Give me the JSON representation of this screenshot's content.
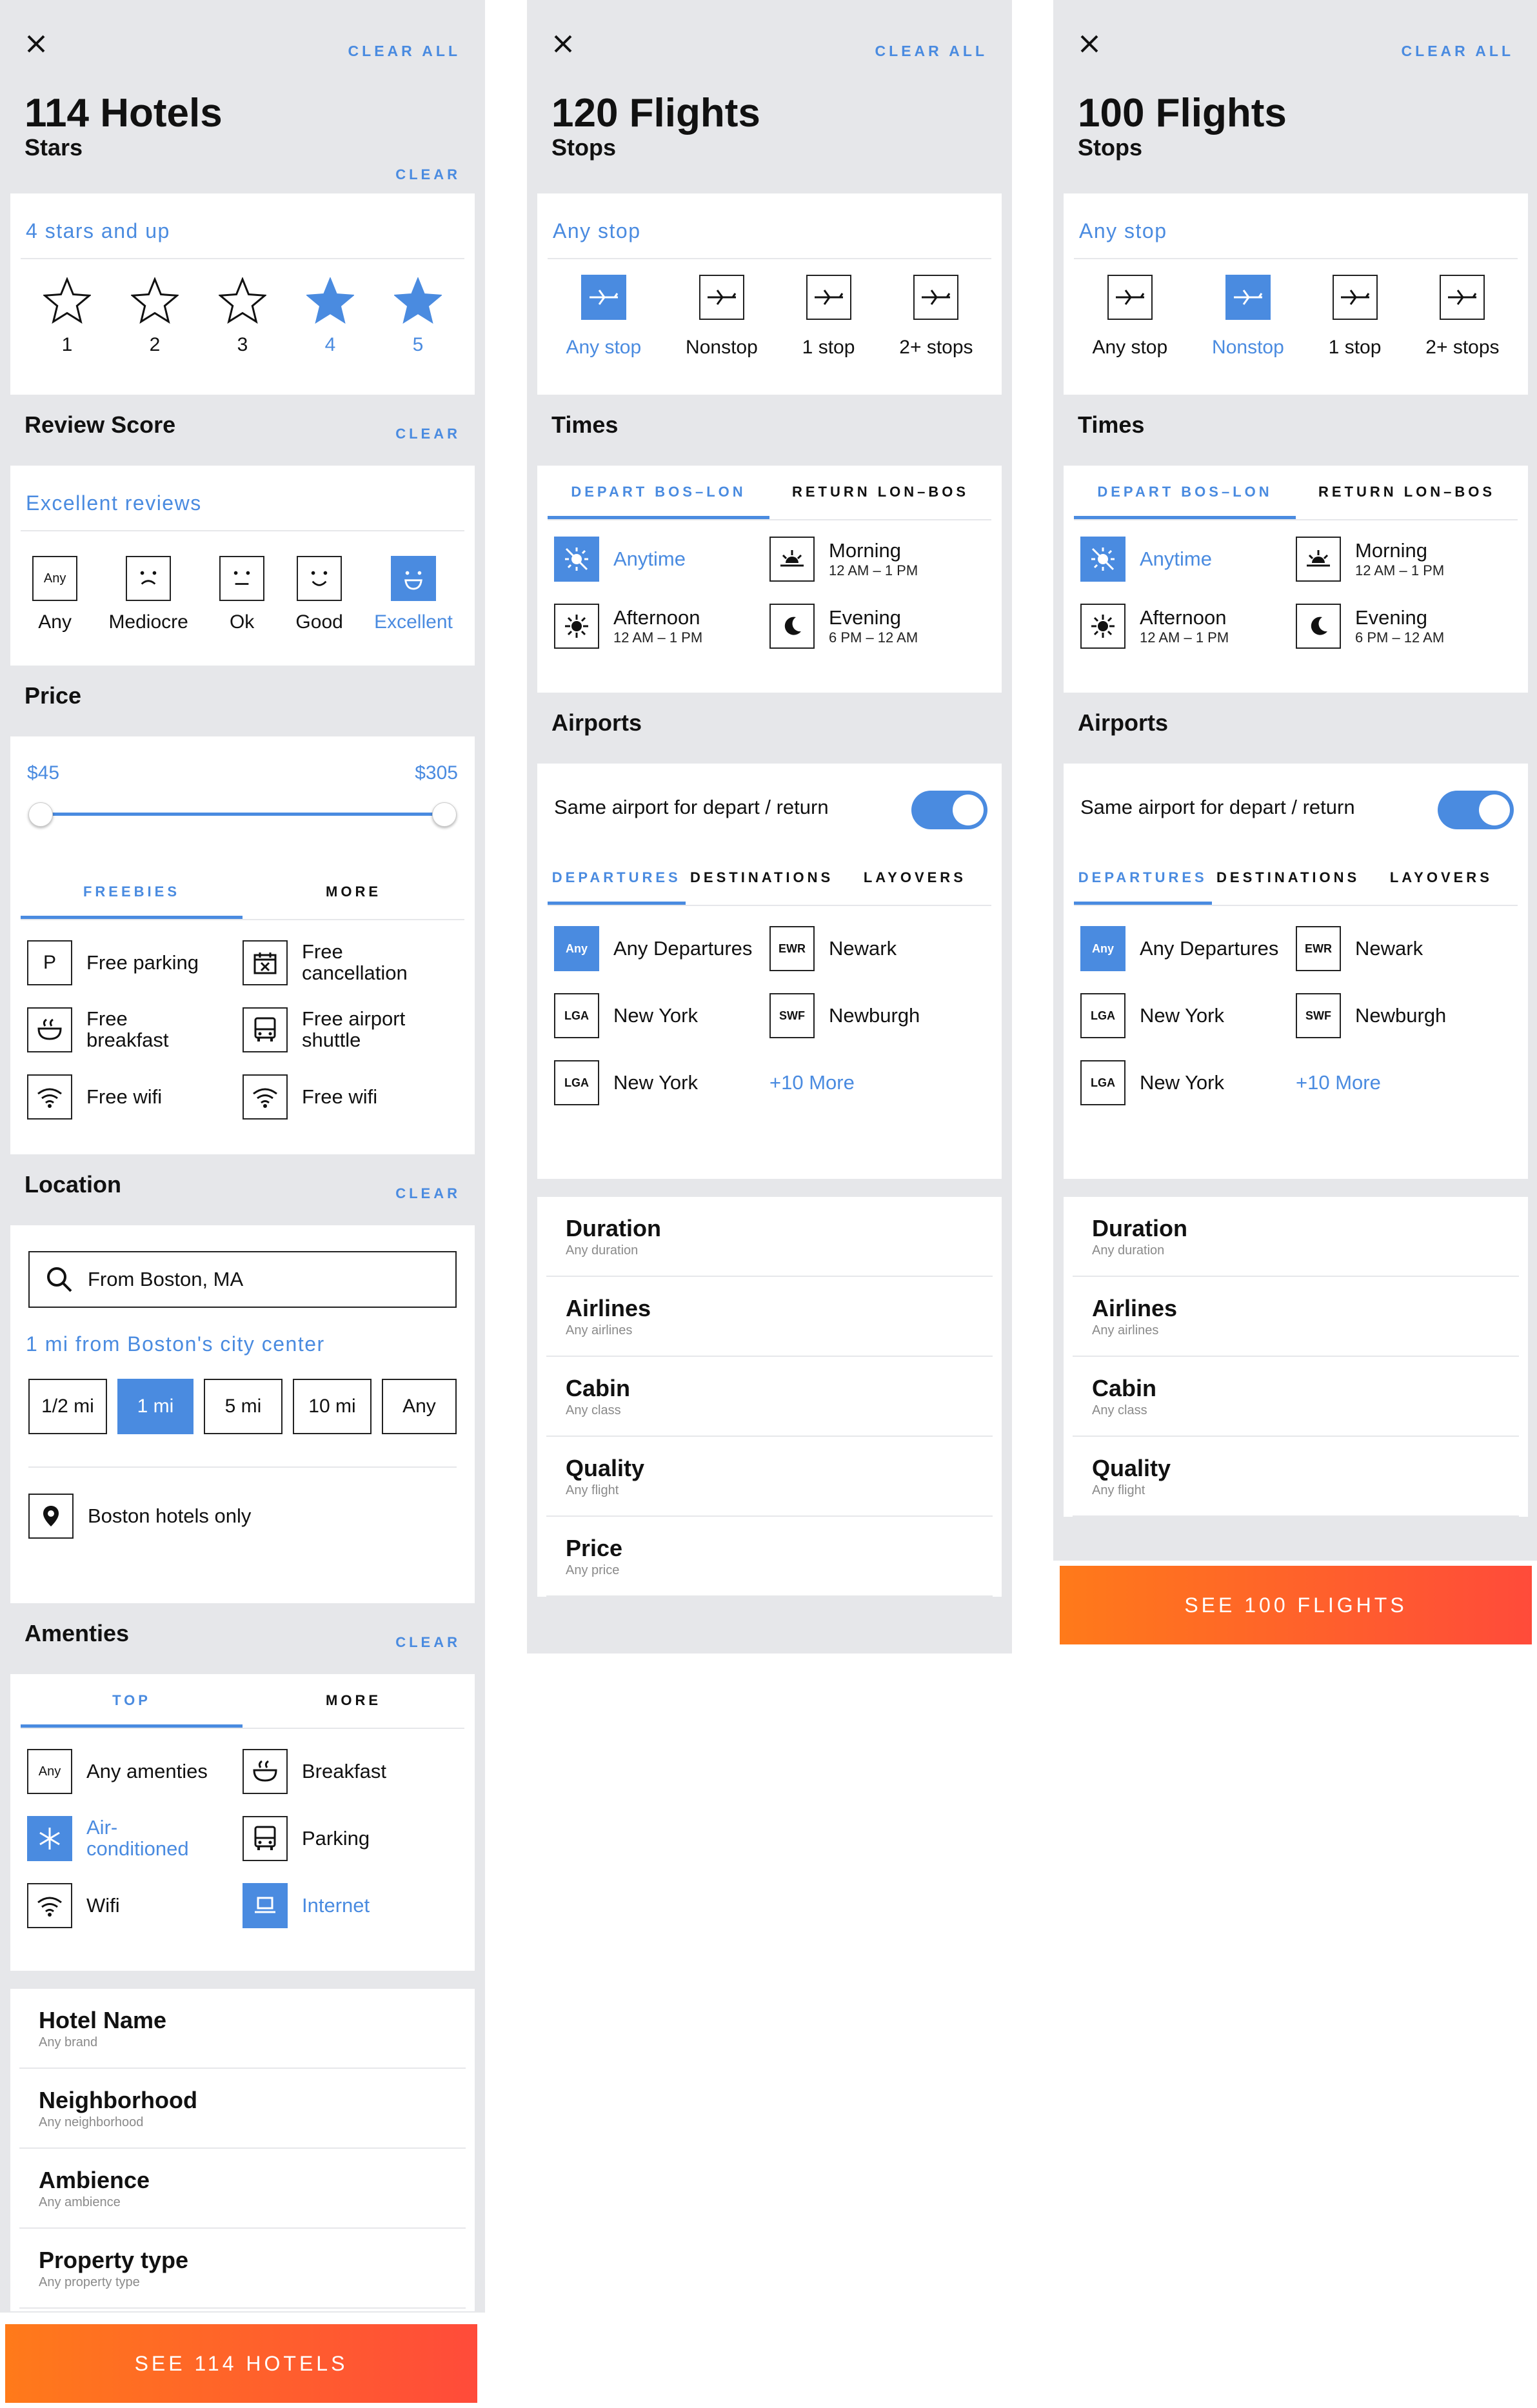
{
  "hotels": {
    "clear_all": "CLEAR ALL",
    "title": "114 Hotels",
    "stars": {
      "heading": "Stars",
      "clear": "CLEAR",
      "caption": "4 stars and up",
      "options": [
        "1",
        "2",
        "3",
        "4",
        "5"
      ],
      "selected_from": 4
    },
    "review": {
      "heading": "Review Score",
      "clear": "CLEAR",
      "caption": "Excellent reviews",
      "options": [
        {
          "label": "Any",
          "icon": "any"
        },
        {
          "label": "Mediocre",
          "icon": "frown-face-icon"
        },
        {
          "label": "Ok",
          "icon": "neutral-face-icon"
        },
        {
          "label": "Good",
          "icon": "smile-face-icon"
        },
        {
          "label": "Excellent",
          "icon": "grin-face-icon"
        }
      ],
      "selected": "Excellent"
    },
    "price": {
      "heading": "Price",
      "min": "$45",
      "max": "$305",
      "range_min_fraction": 0.0,
      "range_max_fraction": 1.0,
      "tabs": [
        "FREEBIES",
        "MORE"
      ],
      "items": [
        {
          "label": "Free parking",
          "icon": "P"
        },
        {
          "label": "Free cancellation",
          "icon": "calendar-x-icon"
        },
        {
          "label": "Free breakfast",
          "icon": "bowl-icon"
        },
        {
          "label": "Free airport shuttle",
          "icon": "bus-icon"
        },
        {
          "label": "Free wifi",
          "icon": "wifi-icon"
        },
        {
          "label": "Free wifi",
          "icon": "wifi-icon"
        }
      ]
    },
    "location": {
      "heading": "Location",
      "clear": "CLEAR",
      "search_value": "From Boston, MA",
      "caption": "1 mi from Boston's city center",
      "chips": [
        "1/2 mi",
        "1 mi",
        "5 mi",
        "10 mi",
        "Any"
      ],
      "selected_chip": "1 mi",
      "only_label": "Boston hotels only"
    },
    "amenities": {
      "heading": "Amenties",
      "clear": "CLEAR",
      "tabs": [
        "TOP",
        "MORE"
      ],
      "items": [
        {
          "label": "Any amenties",
          "icon": "Any"
        },
        {
          "label": "Breakfast",
          "icon": "bowl-icon"
        },
        {
          "label": "Air-conditioned",
          "icon": "snowflake-icon",
          "on": true
        },
        {
          "label": "Parking",
          "icon": "bus-icon"
        },
        {
          "label": "Wifi",
          "icon": "wifi-icon"
        },
        {
          "label": "Internet",
          "icon": "laptop-icon",
          "on": true
        }
      ]
    },
    "list": [
      {
        "a": "Hotel Name",
        "b": "Any brand"
      },
      {
        "a": "Neighborhood",
        "b": "Any neighborhood"
      },
      {
        "a": "Ambience",
        "b": "Any ambience"
      },
      {
        "a": "Property type",
        "b": "Any property type"
      }
    ],
    "cta": "SEE 114 HOTELS"
  },
  "flights1": {
    "clear_all": "CLEAR ALL",
    "title": "120 Flights",
    "stops": {
      "heading": "Stops",
      "caption": "Any stop",
      "options": [
        "Any stop",
        "Nonstop",
        "1 stop",
        "2+ stops"
      ],
      "selected": "Any stop"
    },
    "times": {
      "heading": "Times",
      "tabs": [
        "DEPART BOS–LON",
        "RETURN LON–BOS"
      ],
      "items": [
        {
          "label": "Anytime",
          "sub": "",
          "icon": "sun-off-icon",
          "on": true
        },
        {
          "label": "Morning",
          "sub": "12 AM – 1 PM",
          "icon": "sunrise-icon"
        },
        {
          "label": "Afternoon",
          "sub": "12 AM – 1 PM",
          "icon": "sun-icon"
        },
        {
          "label": "Evening",
          "sub": "6 PM – 12 AM",
          "icon": "moon-icon"
        }
      ]
    },
    "airports": {
      "heading": "Airports",
      "same_label": "Same airport for depart / return",
      "tabs": [
        "DEPARTURES",
        "DESTINATIONS",
        "LAYOVERS"
      ],
      "items": [
        {
          "code": "Any",
          "label": "Any Departures",
          "on": true
        },
        {
          "code": "EWR",
          "label": "Newark"
        },
        {
          "code": "LGA",
          "label": "New York"
        },
        {
          "code": "SWF",
          "label": "Newburgh"
        },
        {
          "code": "LGA",
          "label": "New York"
        }
      ],
      "more": "+10 More"
    },
    "list": [
      {
        "a": "Duration",
        "b": "Any duration"
      },
      {
        "a": "Airlines",
        "b": "Any airlines"
      },
      {
        "a": "Cabin",
        "b": "Any class"
      },
      {
        "a": "Quality",
        "b": "Any flight"
      },
      {
        "a": "Price",
        "b": "Any price"
      }
    ]
  },
  "flights2": {
    "clear_all": "CLEAR ALL",
    "title": "100 Flights",
    "stops": {
      "heading": "Stops",
      "caption": "Any stop",
      "options": [
        "Any stop",
        "Nonstop",
        "1 stop",
        "2+ stops"
      ],
      "selected": "Nonstop"
    },
    "times": {
      "heading": "Times",
      "tabs": [
        "DEPART BOS–LON",
        "RETURN LON–BOS"
      ],
      "items": [
        {
          "label": "Anytime",
          "sub": "",
          "icon": "sun-off-icon",
          "on": true
        },
        {
          "label": "Morning",
          "sub": "12 AM – 1 PM",
          "icon": "sunrise-icon"
        },
        {
          "label": "Afternoon",
          "sub": "12 AM – 1 PM",
          "icon": "sun-icon"
        },
        {
          "label": "Evening",
          "sub": "6 PM – 12 AM",
          "icon": "moon-icon"
        }
      ]
    },
    "airports": {
      "heading": "Airports",
      "same_label": "Same airport for depart / return",
      "tabs": [
        "DEPARTURES",
        "DESTINATIONS",
        "LAYOVERS"
      ],
      "items": [
        {
          "code": "Any",
          "label": "Any Departures",
          "on": true
        },
        {
          "code": "EWR",
          "label": "Newark"
        },
        {
          "code": "LGA",
          "label": "New York"
        },
        {
          "code": "SWF",
          "label": "Newburgh"
        },
        {
          "code": "LGA",
          "label": "New York"
        }
      ],
      "more": "+10 More"
    },
    "list": [
      {
        "a": "Duration",
        "b": "Any duration"
      },
      {
        "a": "Airlines",
        "b": "Any airlines"
      },
      {
        "a": "Cabin",
        "b": "Any class"
      },
      {
        "a": "Quality",
        "b": "Any flight"
      }
    ],
    "cta": "SEE 100 FLIGHTS"
  },
  "colors": {
    "accent": "#4a8be0",
    "cta_start": "#ff7a1a",
    "cta_end": "#ff4b3a",
    "panel_bg": "#e6e7ea"
  }
}
